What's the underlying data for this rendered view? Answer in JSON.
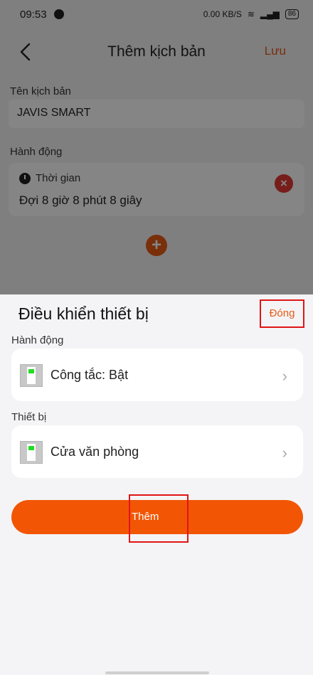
{
  "status_bar": {
    "time": "09:53",
    "network_speed": "0.00 KB/S",
    "battery": "86"
  },
  "header": {
    "title": "Thêm kịch bản",
    "save_label": "Lưu"
  },
  "form": {
    "name_label": "Tên kịch bản",
    "name_value": "JAVIS SMART",
    "actions_label": "Hành động",
    "action": {
      "type": "Thời gian",
      "description": "Đợi 8 giờ 8 phút 8 giây"
    }
  },
  "sheet": {
    "title": "Điều khiển thiết bị",
    "close_label": "Đóng",
    "action_section_label": "Hành động",
    "action_value": "Công tắc: Bật",
    "device_section_label": "Thiết bị",
    "device_value": "Cửa văn phòng",
    "add_label": "Thêm"
  },
  "colors": {
    "accent": "#f25605",
    "highlight": "#e01515",
    "remove": "#e53935"
  },
  "icons": [
    "back-icon",
    "clock-icon",
    "remove-icon",
    "add-icon",
    "switch-icon",
    "chevron-right-icon"
  ]
}
